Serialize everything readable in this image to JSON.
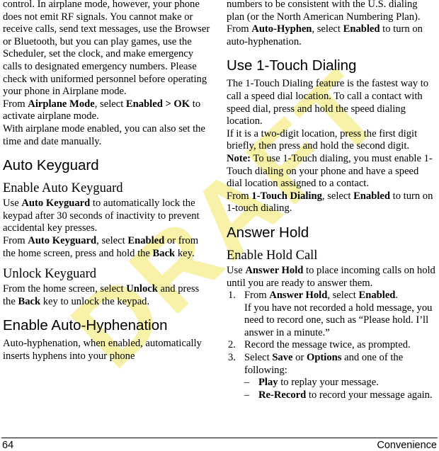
{
  "watermark": {
    "text": "DRAFT",
    "color": "#f7f2a8"
  },
  "footer": {
    "page_number": "64",
    "chapter": "Convenience"
  },
  "left_column": {
    "blocks": [
      {
        "kind": "paragraph",
        "name": "airplane-mode-description",
        "runs": [
          {
            "text": "control. In airplane mode, however, your phone does not emit RF signals. You cannot make or receive calls, send text messages, use the Browser or Bluetooth, but you can play games, use the Scheduler, set the clock, and make emergency calls to designated emergency numbers. Please check with uniformed personnel before operating your phone in Airplane mode.",
            "bold": false
          }
        ]
      },
      {
        "kind": "paragraph",
        "name": "airplane-mode-step",
        "runs": [
          {
            "text": "From ",
            "bold": false
          },
          {
            "text": "Airplane Mode",
            "bold": true
          },
          {
            "text": ", select ",
            "bold": false
          },
          {
            "text": "Enabled > OK",
            "bold": true
          },
          {
            "text": " to activate airplane mode.",
            "bold": false
          }
        ]
      },
      {
        "kind": "paragraph",
        "name": "airplane-mode-note",
        "runs": [
          {
            "text": "With airplane mode enabled, you can also set the time and date manually.",
            "bold": false
          }
        ]
      },
      {
        "kind": "h1",
        "name": "heading-auto-keyguard",
        "text": "Auto Keyguard"
      },
      {
        "kind": "h2",
        "name": "heading-enable-auto-keyguard",
        "text": "Enable Auto Keyguard"
      },
      {
        "kind": "paragraph",
        "name": "auto-keyguard-description",
        "runs": [
          {
            "text": "Use ",
            "bold": false
          },
          {
            "text": "Auto Keyguard",
            "bold": true
          },
          {
            "text": " to automatically lock the keypad after 30 seconds of inactivity to prevent accidental key presses.",
            "bold": false
          }
        ]
      },
      {
        "kind": "paragraph",
        "name": "auto-keyguard-step",
        "runs": [
          {
            "text": "From ",
            "bold": false
          },
          {
            "text": "Auto Keyguard",
            "bold": true
          },
          {
            "text": ", select ",
            "bold": false
          },
          {
            "text": "Enabled",
            "bold": true
          },
          {
            "text": " or from the home screen, press and hold the ",
            "bold": false
          },
          {
            "text": "Back",
            "bold": true
          },
          {
            "text": " key.",
            "bold": false
          }
        ]
      },
      {
        "kind": "h2",
        "name": "heading-unlock-keyguard",
        "text": "Unlock Keyguard"
      },
      {
        "kind": "paragraph",
        "name": "unlock-keyguard-step",
        "runs": [
          {
            "text": "From the home screen, select ",
            "bold": false
          },
          {
            "text": "Unlock",
            "bold": true
          },
          {
            "text": " and press the ",
            "bold": false
          },
          {
            "text": "Back",
            "bold": true
          },
          {
            "text": " key to unlock the keypad.",
            "bold": false
          }
        ]
      },
      {
        "kind": "h1",
        "name": "heading-enable-auto-hyphenation",
        "text": "Enable Auto-Hyphenation"
      },
      {
        "kind": "paragraph",
        "name": "auto-hyphenation-description-part1",
        "runs": [
          {
            "text": "Auto-hyphenation, when enabled, automatically inserts hyphens into your phone",
            "bold": false
          }
        ]
      }
    ]
  },
  "right_column": {
    "blocks": [
      {
        "kind": "paragraph",
        "name": "auto-hyphenation-description-part2",
        "runs": [
          {
            "text": "numbers to be consistent with the U.S. dialing plan (or the North American Numbering Plan).",
            "bold": false
          }
        ]
      },
      {
        "kind": "paragraph",
        "name": "auto-hyphen-step",
        "runs": [
          {
            "text": "From ",
            "bold": false
          },
          {
            "text": "Auto-Hyphen",
            "bold": true
          },
          {
            "text": ", select ",
            "bold": false
          },
          {
            "text": "Enabled",
            "bold": true
          },
          {
            "text": " to turn on auto-hyphenation.",
            "bold": false
          }
        ]
      },
      {
        "kind": "h1",
        "name": "heading-use-1-touch-dialing",
        "text": "Use 1-Touch Dialing"
      },
      {
        "kind": "paragraph",
        "name": "one-touch-dialing-description",
        "runs": [
          {
            "text": "The 1-Touch Dialing feature is the fastest way to call a speed dial location. To call a contact with speed dial, press and hold the speed dialing location.",
            "bold": false
          }
        ]
      },
      {
        "kind": "paragraph",
        "name": "one-touch-dialing-two-digit",
        "runs": [
          {
            "text": "If it is a two-digit location, press the first digit briefly, then press and hold the second digit.",
            "bold": false
          }
        ]
      },
      {
        "kind": "paragraph",
        "name": "one-touch-dialing-note",
        "runs": [
          {
            "text": "Note:",
            "bold": true
          },
          {
            "text": " To use 1-Touch dialing, you must enable 1-Touch dialing on your phone and have a speed dial location assigned to a contact.",
            "bold": false
          }
        ]
      },
      {
        "kind": "paragraph",
        "name": "one-touch-dialing-step",
        "runs": [
          {
            "text": "From ",
            "bold": false
          },
          {
            "text": "1-Touch Dialing",
            "bold": true
          },
          {
            "text": ", select ",
            "bold": false
          },
          {
            "text": "Enabled",
            "bold": true
          },
          {
            "text": " to turn on 1-touch dialing.",
            "bold": false
          }
        ]
      },
      {
        "kind": "h1",
        "name": "heading-answer-hold",
        "text": "Answer Hold"
      },
      {
        "kind": "h2",
        "name": "heading-enable-hold-call",
        "text": "Enable Hold Call"
      },
      {
        "kind": "paragraph",
        "name": "answer-hold-description",
        "runs": [
          {
            "text": "Use ",
            "bold": false
          },
          {
            "text": "Answer Hold",
            "bold": true
          },
          {
            "text": " to place incoming calls on hold until you are ready to answer them.",
            "bold": false
          }
        ]
      },
      {
        "kind": "numlist",
        "name": "answer-hold-steps",
        "items": [
          {
            "marker": "1.",
            "runs": [
              {
                "text": "From ",
                "bold": false
              },
              {
                "text": "Answer Hold",
                "bold": true
              },
              {
                "text": ", select ",
                "bold": false
              },
              {
                "text": "Enabled",
                "bold": true
              },
              {
                "text": ".",
                "bold": false
              }
            ],
            "continuation": [
              {
                "text": "If you have not recorded a hold message, you need to record one, such as “Please hold. I’ll answer in a minute.”",
                "bold": false
              }
            ]
          },
          {
            "marker": "2.",
            "runs": [
              {
                "text": "Record the message twice, as prompted.",
                "bold": false
              }
            ]
          },
          {
            "marker": "3.",
            "runs": [
              {
                "text": "Select ",
                "bold": false
              },
              {
                "text": "Save",
                "bold": true
              },
              {
                "text": " or ",
                "bold": false
              },
              {
                "text": "Options",
                "bold": true
              },
              {
                "text": " and one of the following:",
                "bold": false
              }
            ],
            "sublist": [
              {
                "marker": "–",
                "runs": [
                  {
                    "text": "Play",
                    "bold": true
                  },
                  {
                    "text": " to replay your message.",
                    "bold": false
                  }
                ]
              },
              {
                "marker": "–",
                "runs": [
                  {
                    "text": "Re-Record",
                    "bold": true
                  },
                  {
                    "text": " to record your message again.",
                    "bold": false
                  }
                ]
              }
            ]
          }
        ]
      }
    ]
  }
}
